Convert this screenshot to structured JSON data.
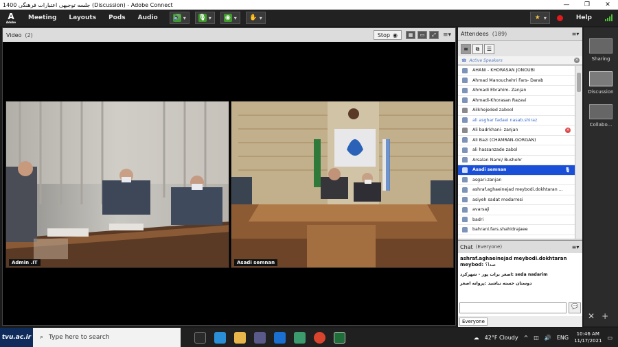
{
  "window": {
    "title": "جلسه توجیهی اعتبارات فرهنگی 1400 (Discussion) - Adobe Connect",
    "minimize": "—",
    "maximize": "❐",
    "close": "✕"
  },
  "menubar": {
    "logo_mark": "A",
    "logo_text": "Adobe",
    "items": [
      "Meeting",
      "Layouts",
      "Pods",
      "Audio"
    ],
    "help": "Help"
  },
  "video_pod": {
    "title": "Video",
    "count": "(2)",
    "stop_label": "Stop",
    "feeds": [
      {
        "label": "Admin .IT"
      },
      {
        "label": "Asadi semnan"
      }
    ]
  },
  "attendees": {
    "title": "Attendees",
    "count": "(189)",
    "section": "Active Speakers",
    "rows": [
      {
        "name": "AHANI - KHORASAN JONOUBI"
      },
      {
        "name": "Ahmad Manouchehri  Fars- Darab"
      },
      {
        "name": "Ahmadi Ebrahim- Zanjan"
      },
      {
        "name": "Ahmadi-Khorasan Razavi"
      },
      {
        "name": "Ailkhejeded  zabool"
      },
      {
        "name": "ali asghar fadaei nasab.shiraz"
      },
      {
        "name": "Ali badrkhani- zanjan"
      },
      {
        "name": "Ali Bazi (CHAMRAN-GORGAN)"
      },
      {
        "name": "ali hassanzade  zabol"
      },
      {
        "name": "Arsalan  Nami/ Bushehr"
      },
      {
        "name": "Asadi semnan"
      },
      {
        "name": "asgari-zanjan"
      },
      {
        "name": "ashraf.aghaeinejad meybodi.dokhtaran ..."
      },
      {
        "name": "asiyeh sadat modarresi"
      },
      {
        "name": "avarsaji"
      },
      {
        "name": "badri"
      },
      {
        "name": "bahrani.fars.shahidrajaee"
      }
    ]
  },
  "chat": {
    "title": "Chat",
    "audience": "(Everyone)",
    "author": "ashraf.aghaeinejad meybodi.dokhtaran meybod:",
    "author_suffix": "صدا؟",
    "messages": [
      "اصغر برات پور - شهرکرد: seda nadarim",
      "دوستان خسته نباشید :پروانه اصغر"
    ],
    "footer_tab": "Everyone"
  },
  "layouts": [
    {
      "label": "Sharing"
    },
    {
      "label": "Discussion"
    },
    {
      "label": "Collabo..."
    }
  ],
  "taskbar": {
    "brand": "tvu.ac.ir",
    "search_placeholder": "Type here to search",
    "weather": "42°F  Cloudy",
    "lang": "ENG",
    "time": "10:46 AM",
    "date": "11/17/2021"
  }
}
